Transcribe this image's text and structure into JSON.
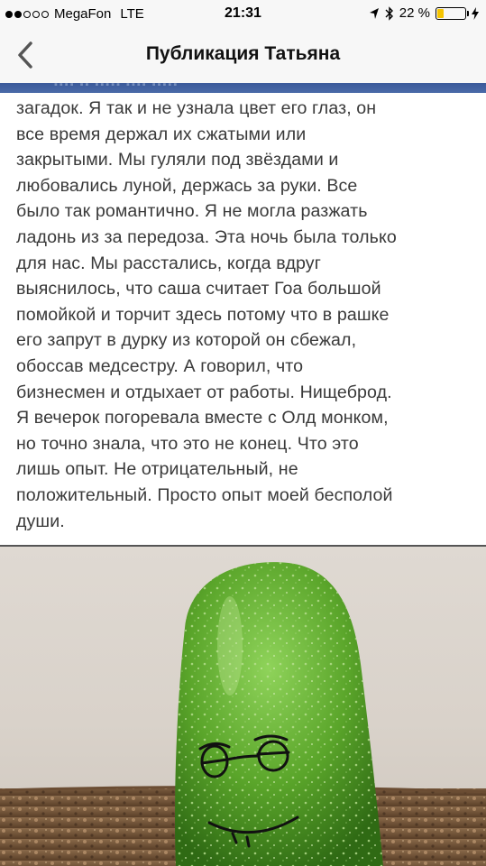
{
  "status_bar": {
    "carrier": "MegaFon",
    "network": "LTE",
    "time": "21:31",
    "battery_percent": "22 %",
    "battery_level": 0.22,
    "signal_bars_filled": 2,
    "signal_bars_total": 5,
    "icons": [
      "location-arrow-icon",
      "bluetooth-icon",
      "battery-icon",
      "charging-icon"
    ]
  },
  "nav": {
    "title": "Публикация Татьяна",
    "back_icon": "chevron-left-icon"
  },
  "post": {
    "text_lines": [
      "загадок. Я так и не узнала цвет его глаз, он",
      "все время держал их сжатыми или",
      "закрытыми. Мы гуляли под звёздами и",
      "любовались луной, держась за руки. Все",
      "было так романтично. Я не могла разжать",
      "ладонь из за передоза. Эта ночь была только",
      "для нас. Мы расстались, когда вдруг",
      "выяснилось, что саша считает Гоа большой",
      "помойкой и торчит здесь потому что в рашке",
      "его запрут в дурку из которой он сбежал,",
      "обоссав медсестру. А говорил, что",
      "бизнесмен и отдыхает от работы. Нищеброд.",
      "Я вечерок погоревала вместе с Олд монком,",
      "но точно знала, что это не конец. Что это",
      "лишь опыт. Не отрицательный, не",
      "положительный. Просто опыт моей бесполой",
      "души."
    ],
    "photo": "cucumber-with-drawn-face"
  },
  "colors": {
    "nav_bg": "#f7f7f7",
    "strip_blue": "#3b5a9a",
    "text": "#3a3a3a",
    "battery": "#f5c400",
    "cucumber": "#5aa52a"
  }
}
